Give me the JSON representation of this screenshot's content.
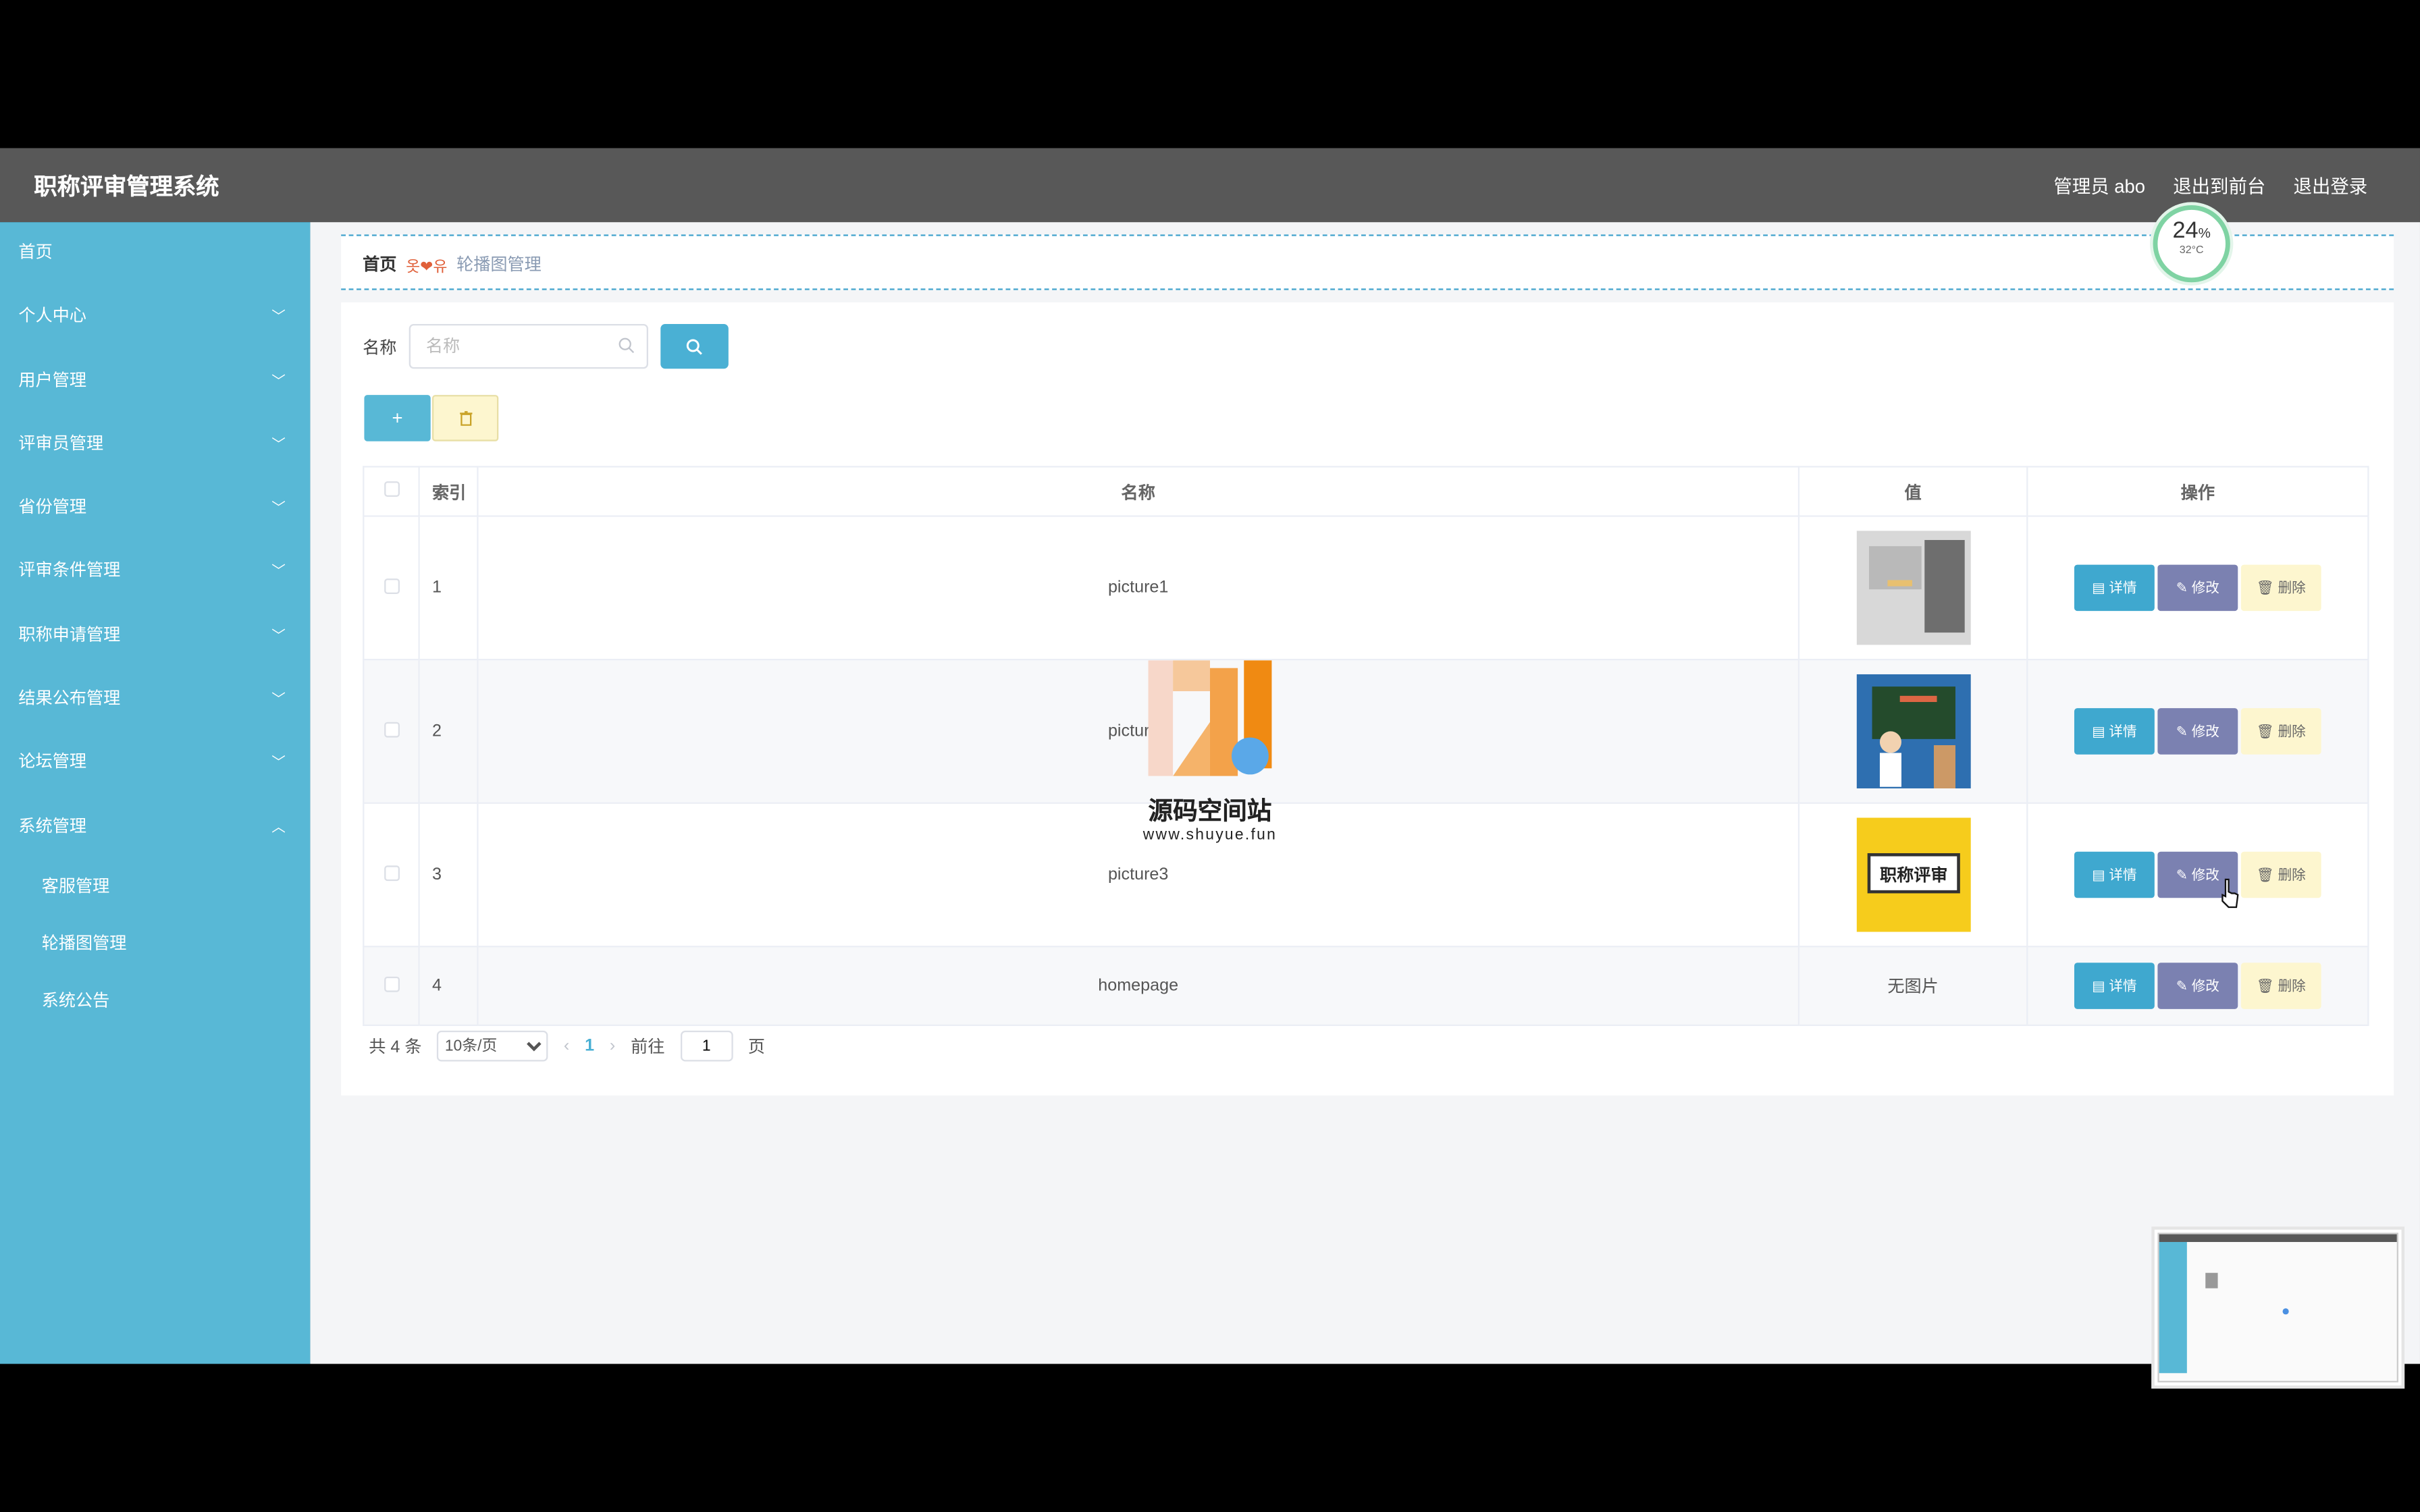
{
  "header": {
    "title": "职称评审管理系统",
    "admin_label": "管理员 abo",
    "to_frontend": "退出到前台",
    "logout": "退出登录"
  },
  "gauge": {
    "value": "24",
    "unit": "%",
    "temperature": "32°C"
  },
  "sidebar": {
    "items": [
      {
        "label": "首页",
        "expandable": false
      },
      {
        "label": "个人中心",
        "expandable": true
      },
      {
        "label": "用户管理",
        "expandable": true
      },
      {
        "label": "评审员管理",
        "expandable": true
      },
      {
        "label": "省份管理",
        "expandable": true
      },
      {
        "label": "评审条件管理",
        "expandable": true
      },
      {
        "label": "职称申请管理",
        "expandable": true
      },
      {
        "label": "结果公布管理",
        "expandable": true
      },
      {
        "label": "论坛管理",
        "expandable": true
      },
      {
        "label": "系统管理",
        "expandable": true,
        "expanded": true
      }
    ],
    "subitems": [
      "客服管理",
      "轮播图管理",
      "系统公告"
    ]
  },
  "breadcrumb": {
    "home": "首页",
    "decoration": "옷❤유",
    "current": "轮播图管理"
  },
  "search": {
    "label": "名称",
    "placeholder": "名称"
  },
  "actions": {
    "add": "+"
  },
  "table": {
    "headers": {
      "index": "索引",
      "name": "名称",
      "value": "值",
      "operations": "操作"
    },
    "rows": [
      {
        "index": "1",
        "name": "picture1",
        "image": "photo-gray",
        "value_text": ""
      },
      {
        "index": "2",
        "name": "picture2",
        "image": "photo-blackboard",
        "value_text": ""
      },
      {
        "index": "3",
        "name": "picture3",
        "image": "photo-yellow-title",
        "value_text": ""
      },
      {
        "index": "4",
        "name": "homepage",
        "image": "",
        "value_text": "无图片"
      }
    ],
    "ops": {
      "detail": "详情",
      "edit": "修改",
      "delete": "删除"
    },
    "image_overlay_text": "职称评审"
  },
  "pagination": {
    "total": "共 4 条",
    "page_size": "10条/页",
    "current_page": "1",
    "goto_prefix": "前往",
    "goto_value": "1",
    "goto_suffix": "页"
  },
  "watermark": {
    "name": "源码空间站",
    "url": "www.shuyue.fun"
  },
  "colors": {
    "sidebar": "#58b8d6",
    "topbar": "#585858",
    "detail": "#3fa8cf",
    "edit": "#7b81b1",
    "delete": "#fdf6cf"
  }
}
